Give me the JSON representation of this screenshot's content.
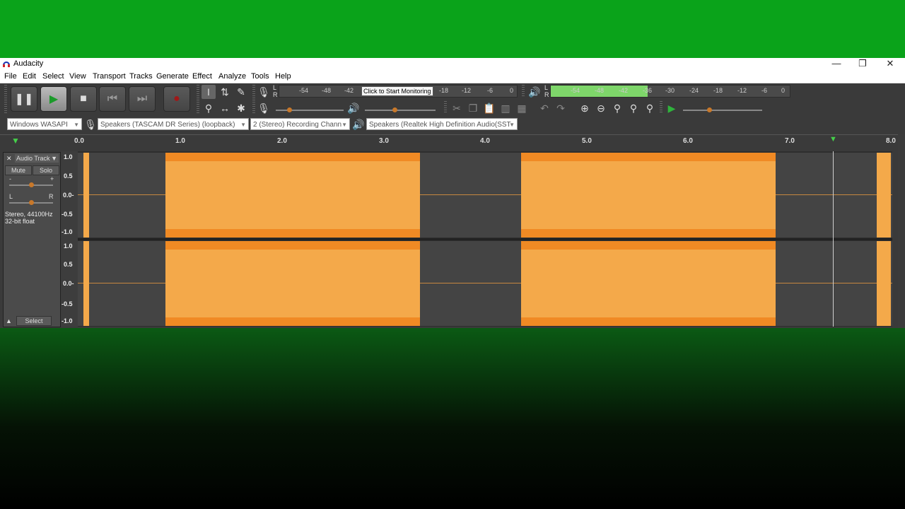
{
  "window": {
    "title": "Audacity",
    "controls": {
      "minimize": "—",
      "restore": "❐",
      "close": "✕"
    }
  },
  "menu": [
    "File",
    "Edit",
    "Select",
    "View",
    "Transport",
    "Tracks",
    "Generate",
    "Effect",
    "Analyze",
    "Tools",
    "Help"
  ],
  "meters": {
    "record_ticks": [
      "-54",
      "-48",
      "-42",
      "-18",
      "-12",
      "-6",
      "0"
    ],
    "record_tooltip": "Click to Start Monitoring",
    "playback_ticks": [
      "-54",
      "-48",
      "-42",
      "-36",
      "-30",
      "-24",
      "-18",
      "-12",
      "-6",
      "0"
    ],
    "channel_l": "L",
    "channel_r": "R"
  },
  "device_toolbar": {
    "host": "Windows WASAPI",
    "recording_device": "Speakers (TASCAM DR Series) (loopback)",
    "channels": "2 (Stereo) Recording Chann",
    "playback_device": "Speakers (Realtek High Definition Audio(SST"
  },
  "ruler": [
    "0.0",
    "1.0",
    "2.0",
    "3.0",
    "4.0",
    "5.0",
    "6.0",
    "7.0",
    "8.0"
  ],
  "track": {
    "name": "Audio Track",
    "mute": "Mute",
    "solo": "Solo",
    "gain_minus": "-",
    "gain_plus": "+",
    "pan_left": "L",
    "pan_right": "R",
    "info_line1": "Stereo, 44100Hz",
    "info_line2": "32-bit float",
    "select": "Select"
  },
  "vertical_scale": [
    "1.0",
    "0.5",
    "0.0-",
    "-0.5",
    "-1.0"
  ],
  "colors": {
    "waveform": "#f4a94a",
    "waveform_edge": "#f08a24",
    "background_green": "#0aa31a"
  }
}
